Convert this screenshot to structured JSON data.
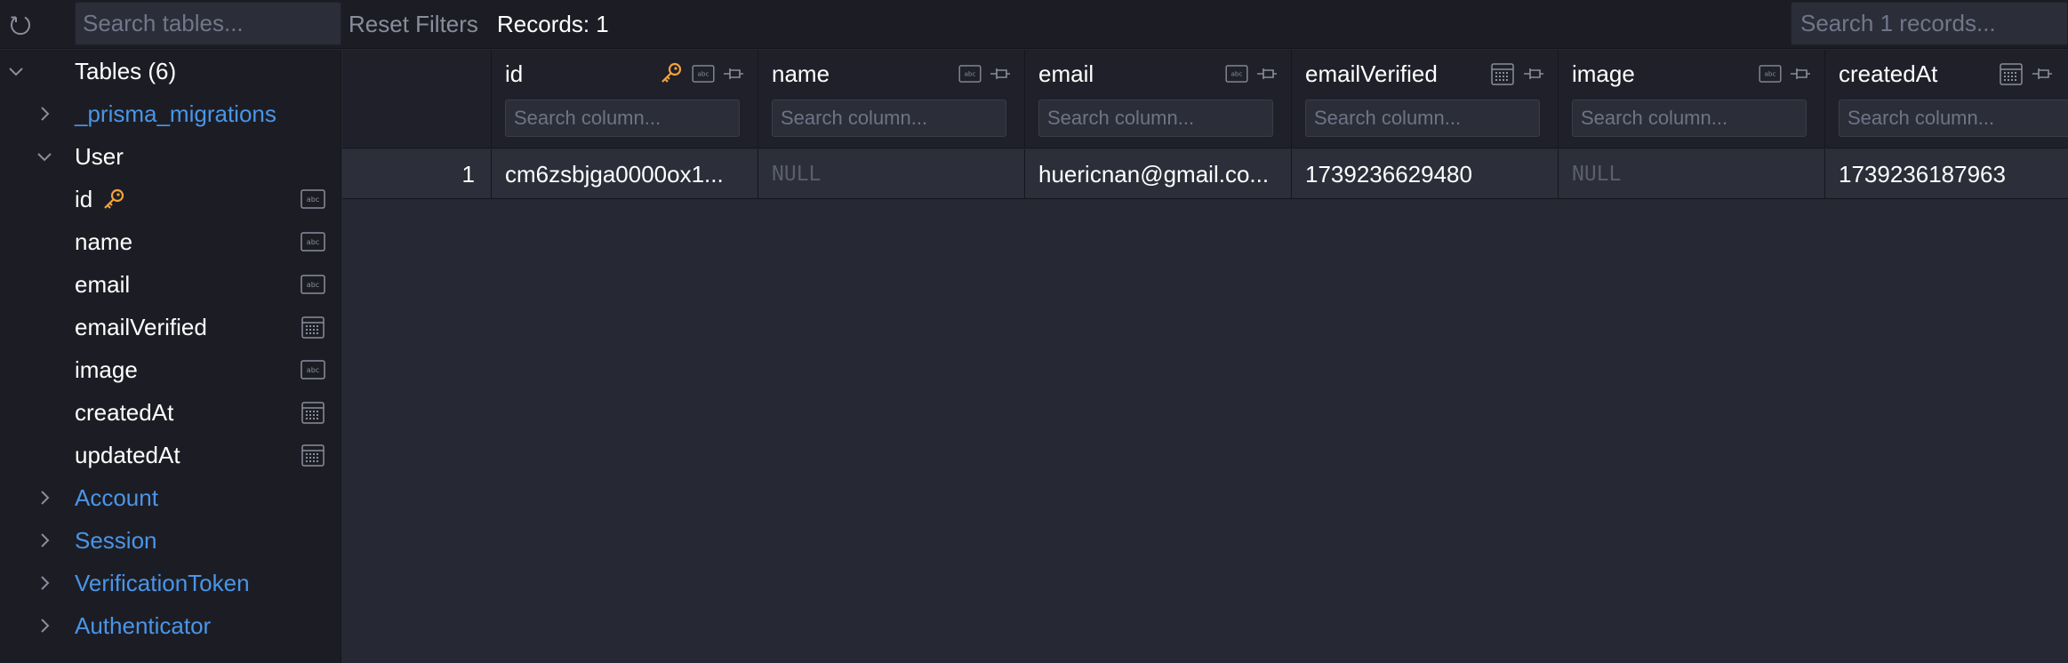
{
  "toolbar": {
    "table_search_placeholder": "Search tables...",
    "reset_filters_label": "Reset Filters",
    "records_label": "Records: 1",
    "records_search_placeholder": "Search 1 records..."
  },
  "sidebar": {
    "tables_header": "Tables (6)",
    "tables": [
      {
        "label": "_prisma_migrations",
        "expanded": false
      },
      {
        "label": "User",
        "expanded": true
      },
      {
        "label": "Account",
        "expanded": false
      },
      {
        "label": "Session",
        "expanded": false
      },
      {
        "label": "VerificationToken",
        "expanded": false
      },
      {
        "label": "Authenticator",
        "expanded": false
      }
    ],
    "user_fields": [
      {
        "label": "id",
        "type_icon": "text-type-icon",
        "primary_key": true
      },
      {
        "label": "name",
        "type_icon": "text-type-icon"
      },
      {
        "label": "email",
        "type_icon": "text-type-icon"
      },
      {
        "label": "emailVerified",
        "type_icon": "calendar-type-icon"
      },
      {
        "label": "image",
        "type_icon": "text-type-icon"
      },
      {
        "label": "createdAt",
        "type_icon": "calendar-type-icon"
      },
      {
        "label": "updatedAt",
        "type_icon": "calendar-type-icon"
      }
    ]
  },
  "grid": {
    "columns": [
      {
        "name": "id",
        "type_icon": "text-type-icon",
        "primary_key": true,
        "search_placeholder": "Search column..."
      },
      {
        "name": "name",
        "type_icon": "text-type-icon",
        "search_placeholder": "Search column..."
      },
      {
        "name": "email",
        "type_icon": "text-type-icon",
        "search_placeholder": "Search column..."
      },
      {
        "name": "emailVerified",
        "type_icon": "calendar-type-icon",
        "search_placeholder": "Search column..."
      },
      {
        "name": "image",
        "type_icon": "text-type-icon",
        "search_placeholder": "Search column..."
      },
      {
        "name": "createdAt",
        "type_icon": "calendar-type-icon",
        "search_placeholder": "Search column..."
      }
    ],
    "rows": [
      {
        "number": "1",
        "cells": [
          "cm6zsbjga0000ox1...",
          "NULL",
          "huericnan@gmail.co...",
          "1739236629480",
          "NULL",
          "1739236187963"
        ]
      }
    ]
  },
  "colors": {
    "link": "#4a95e8",
    "primary_key": "#f2a23c",
    "null_text": "#5b5e6d",
    "toolbar_bg": "#1c1d24",
    "grid_bg": "#262833"
  }
}
